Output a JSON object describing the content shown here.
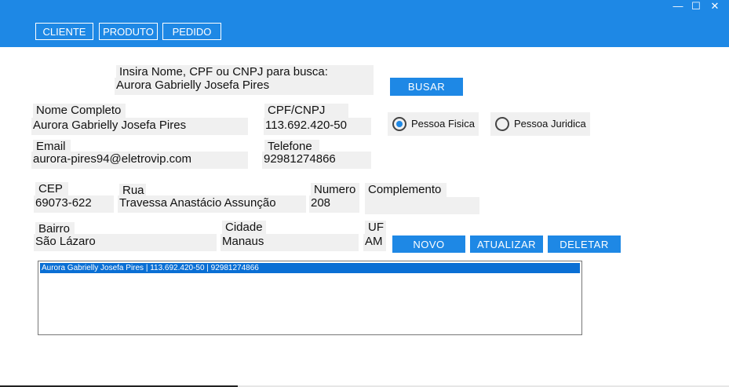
{
  "window": {
    "controls": {
      "minimize": "—",
      "maximize": "☐",
      "close": "✕"
    }
  },
  "menu": {
    "items": [
      {
        "label": "CLIENTE"
      },
      {
        "label": "PRODUTO"
      },
      {
        "label": "PEDIDO"
      }
    ]
  },
  "search": {
    "label": "Insira Nome, CPF ou CNPJ para busca:",
    "value": "Aurora Gabrielly Josefa Pires",
    "button_label": "BUSAR"
  },
  "form": {
    "nome": {
      "label": "Nome Completo",
      "value": "Aurora Gabrielly Josefa Pires"
    },
    "cpf": {
      "label": "CPF/CNPJ",
      "value": "113.692.420-50"
    },
    "email": {
      "label": "Email",
      "value": "aurora-pires94@eletrovip.com"
    },
    "telefone": {
      "label": "Telefone",
      "value": "92981274866"
    },
    "cep": {
      "label": "CEP",
      "value": "69073-622"
    },
    "rua": {
      "label": "Rua",
      "value": "Travessa Anastácio Assunção"
    },
    "numero": {
      "label": "Numero",
      "value": "208"
    },
    "complemento": {
      "label": "Complemento",
      "value": ""
    },
    "bairro": {
      "label": "Bairro",
      "value": "São Lázaro"
    },
    "cidade": {
      "label": "Cidade",
      "value": "Manaus"
    },
    "uf": {
      "label": "UF",
      "value": "AM"
    }
  },
  "person_type": {
    "options": [
      {
        "label": "Pessoa Fisica",
        "selected": true
      },
      {
        "label": "Pessoa Juridica",
        "selected": false
      }
    ]
  },
  "actions": {
    "novo": "NOVO",
    "atualizar": "ATUALIZAR",
    "deletar": "DELETAR"
  },
  "results": {
    "items": [
      "Aurora Gabrielly Josefa Pires | 113.692.420-50 | 92981274866"
    ]
  },
  "colors": {
    "accent": "#1e88e5",
    "field_bg": "#f0f0f0",
    "selection": "#0a6fd4"
  }
}
